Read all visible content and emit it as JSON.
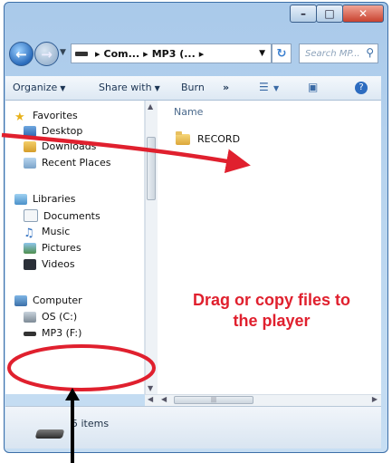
{
  "window": {
    "buttons": {
      "minimize": "–",
      "maximize": "□",
      "close": "✕"
    }
  },
  "address_bar": {
    "path_parts": [
      "Com...",
      "MP3 (..."
    ],
    "separator": "▸",
    "search_placeholder": "Search MP..."
  },
  "toolbar": {
    "organize": "Organize",
    "share_with": "Share with",
    "burn": "Burn",
    "more": "»"
  },
  "sidebar": {
    "favorites": "Favorites",
    "desktop": "Desktop",
    "downloads": "Downloads",
    "recent_places": "Recent Places",
    "libraries": "Libraries",
    "documents": "Documents",
    "music": "Music",
    "pictures": "Pictures",
    "videos": "Videos",
    "computer": "Computer",
    "os_drive": "OS (C:)",
    "mp3_drive": "MP3 (F:)"
  },
  "content": {
    "column_header": "Name",
    "items": [
      "RECORD"
    ]
  },
  "status": {
    "item_count": "5 items"
  },
  "annotation": {
    "line1": "Drag or copy files to",
    "line2": "the player"
  },
  "colors": {
    "annotation_red": "#e0202e",
    "window_frame": "#a9c9ea"
  }
}
